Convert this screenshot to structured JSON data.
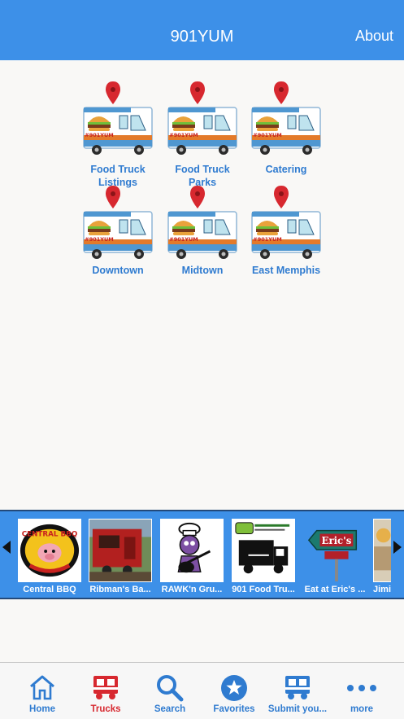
{
  "navbar": {
    "title": "901YUM",
    "about_label": "About"
  },
  "menu": [
    {
      "label": "Food Truck Listings"
    },
    {
      "label": "Food Truck Parks"
    },
    {
      "label": "Catering"
    },
    {
      "label": "Downtown"
    },
    {
      "label": "Midtown"
    },
    {
      "label": "East Memphis"
    }
  ],
  "truck_logo_text": "#901YUM",
  "carousel": [
    {
      "caption": "Central BBQ",
      "logo_text": "CENTRAL BBQ"
    },
    {
      "caption": "Ribman's Ba..."
    },
    {
      "caption": "RAWK'n Gru..."
    },
    {
      "caption": "901 Food Tru..."
    },
    {
      "caption": "Eat at Eric's ...",
      "logo_text": "Eric's"
    },
    {
      "caption": "Jimi..."
    }
  ],
  "tabs": [
    {
      "label": "Home",
      "icon": "home-icon"
    },
    {
      "label": "Trucks",
      "icon": "truck-icon"
    },
    {
      "label": "Search",
      "icon": "search-icon"
    },
    {
      "label": "Favorites",
      "icon": "star-icon"
    },
    {
      "label": "Submit you...",
      "icon": "truck-icon"
    },
    {
      "label": "more",
      "icon": "more-icon"
    }
  ],
  "colors": {
    "bar_blue": "#3d90e8",
    "label_blue": "#2f7bd0",
    "active_red": "#d7282f"
  }
}
